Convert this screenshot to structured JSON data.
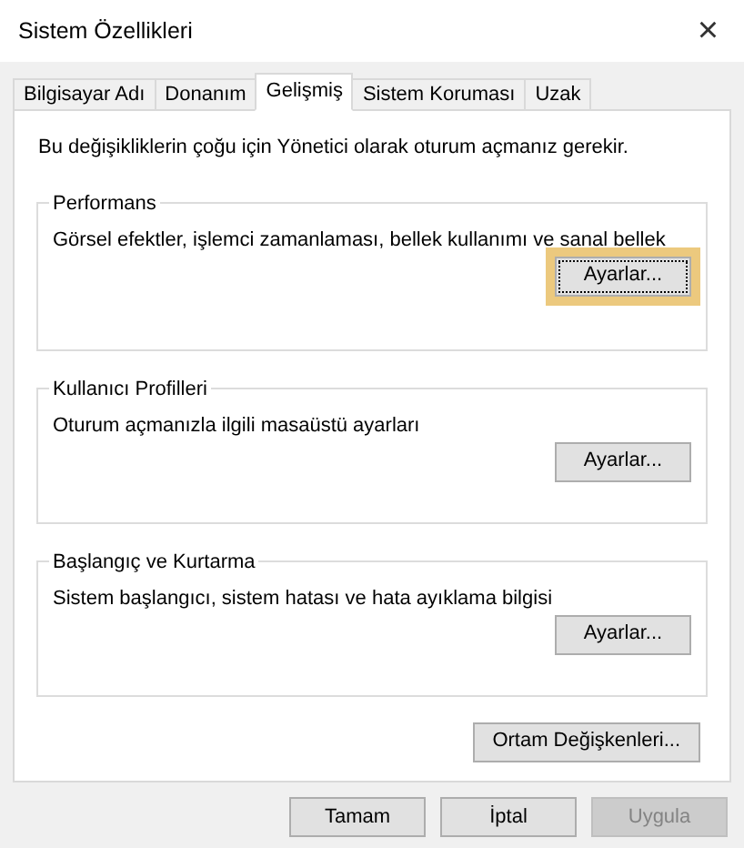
{
  "window": {
    "title": "Sistem Özellikleri",
    "close": "×"
  },
  "tabs": [
    {
      "label": "Bilgisayar Adı",
      "selected": false
    },
    {
      "label": "Donanım",
      "selected": false
    },
    {
      "label": "Gelişmiş",
      "selected": true
    },
    {
      "label": "Sistem Koruması",
      "selected": false
    },
    {
      "label": "Uzak",
      "selected": false
    }
  ],
  "notice": "Bu değişikliklerin çoğu için Yönetici olarak oturum açmanız gerekir.",
  "groups": [
    {
      "title": "Performans",
      "description": "Görsel efektler, işlemci zamanlaması, bellek kullanımı ve sanal bellek",
      "button": {
        "label": "Ayarlar...",
        "highlighted": true
      }
    },
    {
      "title": "Kullanıcı Profilleri",
      "description": "Oturum açmanızla ilgili masaüstü ayarları",
      "button": {
        "label": "Ayarlar...",
        "highlighted": false
      }
    },
    {
      "title": "Başlangıç ve Kurtarma",
      "description": "Sistem başlangıcı, sistem hatası ve hata ayıklama bilgisi",
      "button": {
        "label": "Ayarlar...",
        "highlighted": false
      }
    }
  ],
  "environment_button": "Ortam Değişkenleri...",
  "footer_buttons": [
    {
      "label": "Tamam",
      "disabled": false
    },
    {
      "label": "İptal",
      "disabled": false
    },
    {
      "label": "Uygula",
      "disabled": true
    }
  ]
}
